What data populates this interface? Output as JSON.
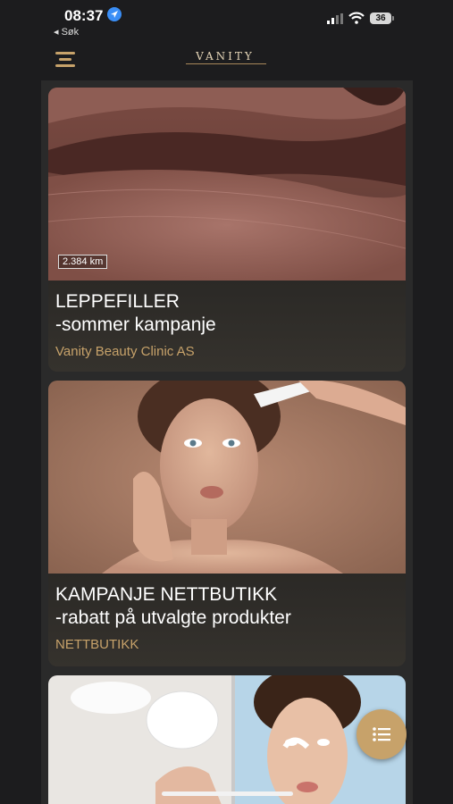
{
  "status_bar": {
    "time": "08:37",
    "back_label": "◂ Søk",
    "battery": "36"
  },
  "header": {
    "logo": "VANITY"
  },
  "cards": [
    {
      "badge": "2.384 km",
      "title": "LEPPEFILLER",
      "subtitle": "-sommer kampanje",
      "tag": "Vanity Beauty Clinic AS"
    },
    {
      "title": "KAMPANJE NETTBUTIKK",
      "subtitle": "-rabatt på utvalgte produkter",
      "tag": "NETTBUTIKK"
    }
  ],
  "colors": {
    "accent": "#c7a26a",
    "background": "#1c1c1e"
  },
  "icons": {
    "menu": "hamburger-menu-icon",
    "fab": "list-icon",
    "location": "location-arrow-icon"
  }
}
